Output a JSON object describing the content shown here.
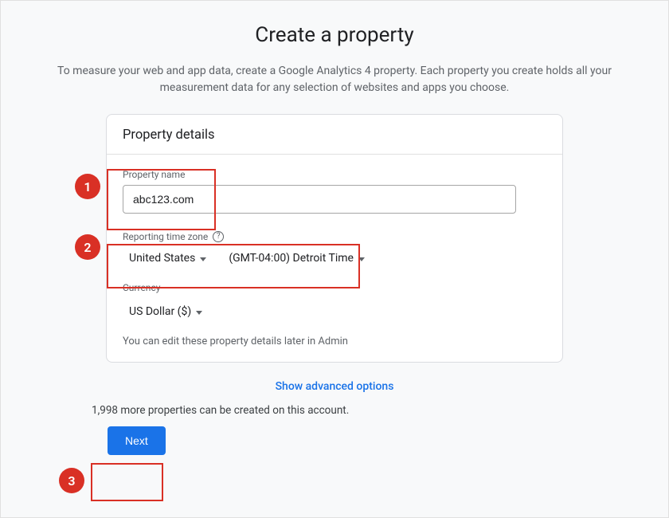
{
  "page": {
    "title": "Create a property",
    "description": "To measure your web and app data, create a Google Analytics 4 property. Each property you create holds all your measurement data for any selection of websites and apps you choose."
  },
  "card": {
    "header": "Property details",
    "property_name_label": "Property name",
    "property_name_value": "abc123.com",
    "reporting_tz_label": "Reporting time zone",
    "country": "United States",
    "timezone": "(GMT-04:00) Detroit Time",
    "currency_label": "Currency",
    "currency_value": "US Dollar ($)",
    "note": "You can edit these property details later in Admin"
  },
  "below": {
    "advanced": "Show advanced options",
    "remaining": "1,998 more properties can be created on this account.",
    "next": "Next"
  },
  "callouts": {
    "one": "1",
    "two": "2",
    "three": "3"
  }
}
